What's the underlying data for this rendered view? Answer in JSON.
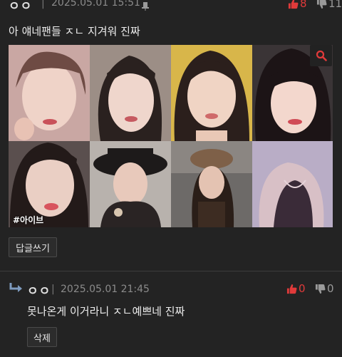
{
  "post": {
    "author": "ㅇㅇ",
    "separator": "|",
    "timestamp": "2025.05.01 15:51",
    "upvotes": "8",
    "downvotes": "11",
    "title": "아 얘네팬들 ㅈㄴ 지겨워 진짜",
    "watermark": "#아이브",
    "reply_button": "답글쓰기"
  },
  "comment": {
    "author": "ㅇㅇ",
    "separator": "|",
    "timestamp": "2025.05.01 21:45",
    "upvotes": "0",
    "downvotes": "0",
    "text": "못나온게 이거라니 ㅈㄴ예쁘네 진짜",
    "delete_button": "삭제"
  },
  "colors": {
    "background": "#232323",
    "upvote": "#e03a3a",
    "downvote": "#9a9a9a",
    "zoom_accent": "#e03a3a"
  },
  "icons": [
    "pin-icon",
    "thumbs-up-icon",
    "thumbs-down-icon",
    "zoom-icon",
    "reply-arrow-icon"
  ]
}
